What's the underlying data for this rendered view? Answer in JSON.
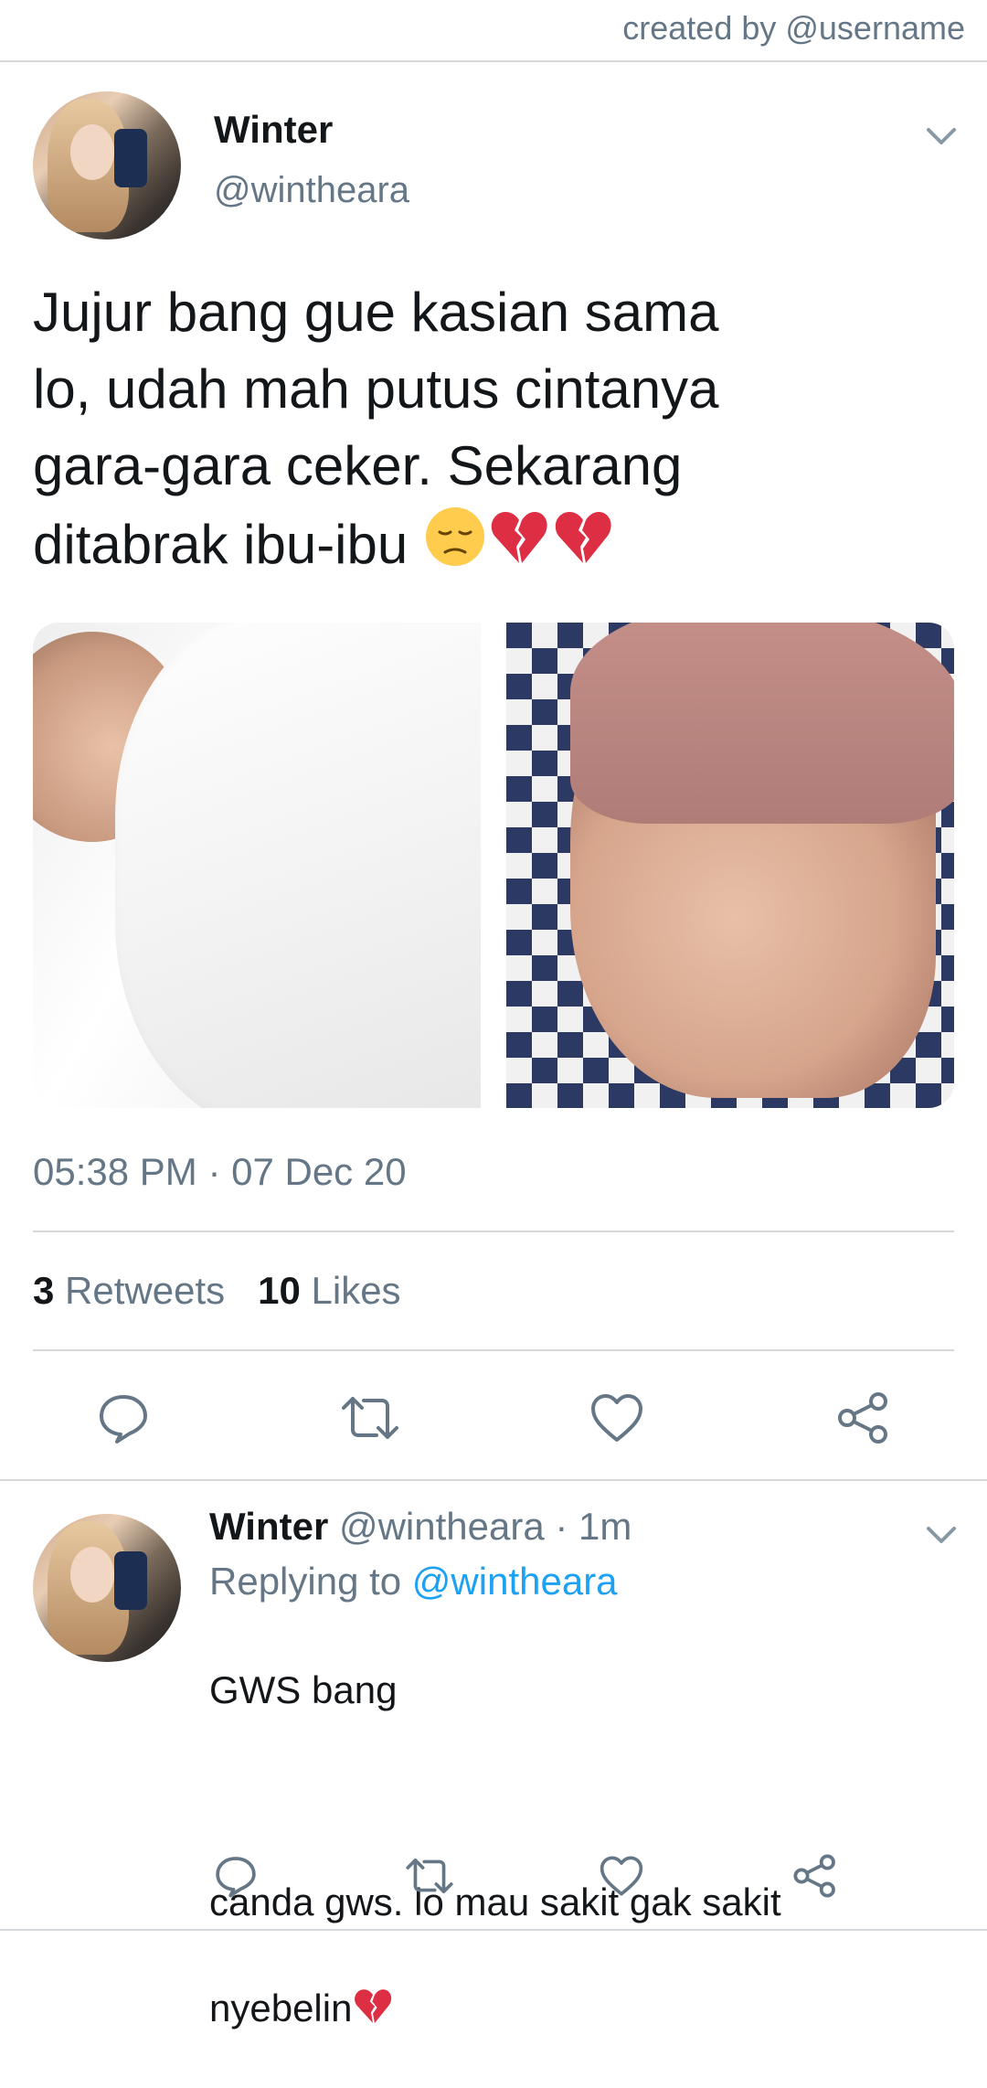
{
  "header": {
    "credit": "created by @username"
  },
  "tweet": {
    "author_name": "Winter",
    "author_handle": "@wintheara",
    "text_line1": "Jujur bang gue kasian sama",
    "text_line2": "lo, udah mah putus cintanya",
    "text_line3": "gara-gara ceker. Sekarang",
    "text_line4": "ditabrak ibu-ibu",
    "timestamp": "05:38 PM · 07 Dec 20",
    "retweets_count": "3",
    "retweets_label": "Retweets",
    "likes_count": "10",
    "likes_label": "Likes"
  },
  "reply": {
    "author_name": "Winter",
    "author_handle": "@wintheara",
    "time": "· 1m",
    "replying_label": "Replying to",
    "replying_handle": "@wintheara",
    "line1": "GWS bang",
    "line2": "canda gws. lo mau sakit gak sakit",
    "line3": "nyebelin"
  },
  "colors": {
    "text": "#14171a",
    "secondary": "#657786",
    "link": "#1da1f2",
    "divider": "#d6d9dc",
    "broken_heart": "#dd2e44"
  }
}
